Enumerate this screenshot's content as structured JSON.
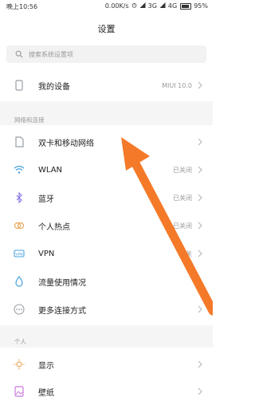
{
  "status_bar": {
    "time": "晚上10:56",
    "network_speed": "0.00K/s",
    "network_type": "3G",
    "network_type_2": "4G",
    "battery": "95%"
  },
  "header": {
    "title": "设置"
  },
  "search": {
    "placeholder": "搜索系统设置项"
  },
  "device": {
    "label": "我的设备",
    "value": "MIUI 10.0"
  },
  "sections": {
    "network": {
      "header": "网络和连接"
    },
    "personal": {
      "header": "个人"
    }
  },
  "network_items": [
    {
      "label": "双卡和移动网络",
      "value": ""
    },
    {
      "label": "WLAN",
      "value": "已关闭"
    },
    {
      "label": "蓝牙",
      "value": "已关闭"
    },
    {
      "label": "个人热点",
      "value": "已关闭"
    },
    {
      "label": "VPN",
      "value": "未关"
    },
    {
      "label": "流量使用情况",
      "value": ""
    },
    {
      "label": "更多连接方式",
      "value": ""
    }
  ],
  "personal_items": [
    {
      "label": "显示"
    },
    {
      "label": "壁纸"
    }
  ],
  "colors": {
    "accent_arrow": "#f47a2a",
    "icon_gray": "#9aa0a6"
  }
}
